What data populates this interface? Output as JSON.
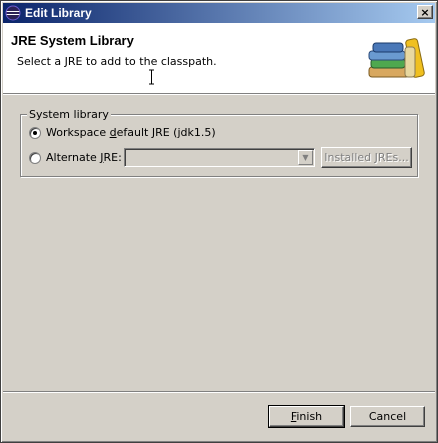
{
  "window": {
    "title": "Edit Library",
    "close_label": "×"
  },
  "header": {
    "title": "JRE System Library",
    "description": "Select a JRE to add to the classpath."
  },
  "group": {
    "legend": "System library",
    "workspace_default": {
      "prefix": "Workspace ",
      "mnemonic": "d",
      "suffix": "efault JRE (jdk1.5)",
      "selected": true
    },
    "alternate": {
      "prefix": "Alternate ",
      "mnemonic": "J",
      "suffix": "RE:",
      "selected": false
    },
    "alternate_combo_value": "",
    "installed_button": "Installed JREs..."
  },
  "footer": {
    "finish": {
      "mnemonic": "F",
      "rest": "inish"
    },
    "cancel": "Cancel"
  },
  "colors": {
    "titlebar_start": "#0a246a",
    "titlebar_end": "#a6caf0",
    "dialog_bg": "#d4d0c8"
  },
  "icons": [
    "eclipse-icon",
    "books-icon",
    "close-icon",
    "text-cursor-icon",
    "chevron-down-icon"
  ]
}
